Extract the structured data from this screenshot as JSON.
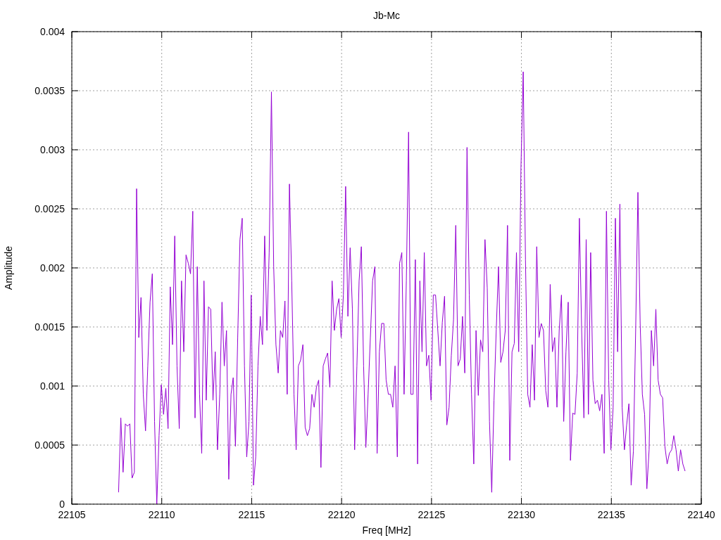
{
  "chart_data": {
    "type": "line",
    "title": "Jb-Mc",
    "xlabel": "Freq [MHz]",
    "ylabel": "Amplitude",
    "grid": true,
    "xlim": [
      22105,
      22140
    ],
    "ylim": [
      0,
      0.004
    ],
    "xticks": [
      22105,
      22110,
      22115,
      22120,
      22125,
      22130,
      22135,
      22140
    ],
    "yticks": [
      0,
      0.0005,
      0.001,
      0.0015,
      0.002,
      0.0025,
      0.003,
      0.0035,
      0.004
    ],
    "x": [
      22107.6,
      22107.725,
      22107.85,
      22107.975,
      22108.1,
      22108.225,
      22108.35,
      22108.475,
      22108.6,
      22108.725,
      22108.85,
      22108.975,
      22109.1,
      22109.225,
      22109.35,
      22109.475,
      22109.6,
      22109.725,
      22109.85,
      22109.975,
      22110.1,
      22110.225,
      22110.35,
      22110.475,
      22110.6,
      22110.725,
      22110.85,
      22110.975,
      22111.1,
      22111.225,
      22111.35,
      22111.475,
      22111.6,
      22111.725,
      22111.85,
      22111.975,
      22112.1,
      22112.225,
      22112.35,
      22112.475,
      22112.6,
      22112.725,
      22112.85,
      22112.975,
      22113.1,
      22113.225,
      22113.35,
      22113.475,
      22113.6,
      22113.725,
      22113.85,
      22113.975,
      22114.1,
      22114.225,
      22114.35,
      22114.475,
      22114.6,
      22114.725,
      22114.85,
      22114.975,
      22115.1,
      22115.225,
      22115.35,
      22115.475,
      22115.6,
      22115.725,
      22115.85,
      22115.975,
      22116.1,
      22116.225,
      22116.35,
      22116.475,
      22116.6,
      22116.725,
      22116.85,
      22116.975,
      22117.1,
      22117.225,
      22117.35,
      22117.475,
      22117.6,
      22117.725,
      22117.85,
      22117.975,
      22118.1,
      22118.225,
      22118.35,
      22118.475,
      22118.6,
      22118.725,
      22118.85,
      22118.975,
      22119.1,
      22119.225,
      22119.35,
      22119.475,
      22119.6,
      22119.725,
      22119.85,
      22119.975,
      22120.1,
      22120.225,
      22120.35,
      22120.475,
      22120.6,
      22120.725,
      22120.85,
      22120.975,
      22121.1,
      22121.225,
      22121.35,
      22121.475,
      22121.6,
      22121.725,
      22121.85,
      22121.975,
      22122.1,
      22122.225,
      22122.35,
      22122.475,
      22122.6,
      22122.725,
      22122.85,
      22122.975,
      22123.1,
      22123.225,
      22123.35,
      22123.475,
      22123.6,
      22123.725,
      22123.85,
      22123.975,
      22124.1,
      22124.225,
      22124.35,
      22124.475,
      22124.6,
      22124.725,
      22124.85,
      22124.975,
      22125.1,
      22125.225,
      22125.35,
      22125.475,
      22125.6,
      22125.725,
      22125.85,
      22125.975,
      22126.1,
      22126.225,
      22126.35,
      22126.475,
      22126.6,
      22126.725,
      22126.85,
      22126.975,
      22127.1,
      22127.225,
      22127.35,
      22127.475,
      22127.6,
      22127.725,
      22127.85,
      22127.975,
      22128.1,
      22128.225,
      22128.35,
      22128.475,
      22128.6,
      22128.725,
      22128.85,
      22128.975,
      22129.1,
      22129.225,
      22129.35,
      22129.475,
      22129.6,
      22129.725,
      22129.85,
      22129.975,
      22130.1,
      22130.225,
      22130.35,
      22130.475,
      22130.6,
      22130.725,
      22130.85,
      22130.975,
      22131.1,
      22131.225,
      22131.35,
      22131.475,
      22131.6,
      22131.725,
      22131.85,
      22131.975,
      22132.1,
      22132.225,
      22132.35,
      22132.475,
      22132.6,
      22132.725,
      22132.85,
      22132.975,
      22133.1,
      22133.225,
      22133.35,
      22133.475,
      22133.6,
      22133.725,
      22133.85,
      22133.975,
      22134.1,
      22134.225,
      22134.35,
      22134.475,
      22134.6,
      22134.725,
      22134.85,
      22134.975,
      22135.1,
      22135.225,
      22135.35,
      22135.475,
      22135.6,
      22135.725,
      22135.85,
      22135.975,
      22136.1,
      22136.225,
      22136.35,
      22136.475,
      22136.6,
      22136.725,
      22136.85,
      22136.975,
      22137.1,
      22137.225,
      22137.35,
      22137.475,
      22137.6,
      22137.725,
      22137.85,
      22137.975,
      22138.1,
      22138.225,
      22138.35,
      22138.475,
      22138.6,
      22138.725,
      22138.85,
      22138.975,
      22139.1
    ],
    "series": [
      {
        "color": "#9400d3",
        "values": [
          0.0001,
          0.00073,
          0.00027,
          0.00068,
          0.00066,
          0.00068,
          0.00022,
          0.00027,
          0.00267,
          0.00141,
          0.00175,
          0.00093,
          0.00062,
          0.00117,
          0.00171,
          0.00195,
          0.0007,
          0,
          0.00058,
          0.00101,
          0.00076,
          0.00098,
          0.00064,
          0.00184,
          0.00135,
          0.00227,
          0.00117,
          0.00064,
          0.00189,
          0.00129,
          0.00211,
          0.00204,
          0.00195,
          0.00248,
          0.00073,
          0.00201,
          0.00093,
          0.00043,
          0.00189,
          0.00088,
          0.00167,
          0.00165,
          0.00088,
          0.00129,
          0.00046,
          0.00093,
          0.00171,
          0.00117,
          0.00147,
          0.00021,
          0.00093,
          0.00107,
          0.00049,
          0.00141,
          0.00224,
          0.00242,
          0.00117,
          0.0004,
          0.0007,
          0.00177,
          0.00016,
          0.0004,
          0.00117,
          0.00159,
          0.00135,
          0.00227,
          0.00147,
          0.00213,
          0.00349,
          0.00201,
          0.00135,
          0.00111,
          0.00147,
          0.00141,
          0.00172,
          0.00093,
          0.00271,
          0.00189,
          0.00093,
          0.00046,
          0.00117,
          0.00122,
          0.00135,
          0.00065,
          0.00058,
          0.00064,
          0.00093,
          0.00082,
          0.00099,
          0.00105,
          0.00031,
          0.00117,
          0.00123,
          0.00128,
          0.00099,
          0.00189,
          0.00147,
          0.00165,
          0.00174,
          0.00141,
          0.00177,
          0.00269,
          0.00159,
          0.00217,
          0.00165,
          0.00046,
          0.00117,
          0.00189,
          0.00218,
          0.00117,
          0.00048,
          0.00093,
          0.00141,
          0.00189,
          0.00201,
          0.00043,
          0.00129,
          0.00153,
          0.00153,
          0.00105,
          0.00093,
          0.00093,
          0.00082,
          0.00117,
          0.0004,
          0.00204,
          0.00213,
          0.00093,
          0.00189,
          0.00315,
          0.00093,
          0.00093,
          0.00207,
          0.00034,
          0.00189,
          0.00129,
          0.00213,
          0.00117,
          0.00126,
          0.00088,
          0.00177,
          0.00177,
          0.00147,
          0.00117,
          0.00154,
          0.00176,
          0.00067,
          0.00082,
          0.00126,
          0.00156,
          0.00236,
          0.00117,
          0.00123,
          0.00159,
          0.00111,
          0.00302,
          0.00177,
          0.00093,
          0.00034,
          0.00147,
          0.00092,
          0.00139,
          0.00129,
          0.00224,
          0.00183,
          0.0007,
          0.0001,
          0.00088,
          0.00148,
          0.00201,
          0.0012,
          0.00129,
          0.00147,
          0.00236,
          0.00037,
          0.00129,
          0.00136,
          0.00213,
          0.00129,
          0.00285,
          0.00366,
          0.00207,
          0.00093,
          0.00082,
          0.00135,
          0.00088,
          0.00218,
          0.00141,
          0.00153,
          0.00147,
          0.00096,
          0.00082,
          0.00186,
          0.00129,
          0.00141,
          0.00082,
          0.00147,
          0.00177,
          0.0007,
          0.00129,
          0.00171,
          0.00037,
          0.00077,
          0.00076,
          0.00111,
          0.00242,
          0.00147,
          0.00073,
          0.00224,
          0.00076,
          0.00213,
          0.00105,
          0.00085,
          0.00088,
          0.00079,
          0.00093,
          0.00043,
          0.00248,
          0.00105,
          0.00046,
          0.00082,
          0.00242,
          0.00129,
          0.00254,
          0.00082,
          0.00046,
          0.00067,
          0.00085,
          0.00016,
          0.00045,
          0.00147,
          0.00264,
          0.00153,
          0.00093,
          0.00076,
          0.00013,
          0.00046,
          0.00147,
          0.00117,
          0.00165,
          0.00105,
          0.00093,
          0.0009,
          0.00049,
          0.00034,
          0.00043,
          0.00046,
          0.00058,
          0.00046,
          0.00028,
          0.00046,
          0.00034,
          0.00028
        ]
      }
    ]
  }
}
